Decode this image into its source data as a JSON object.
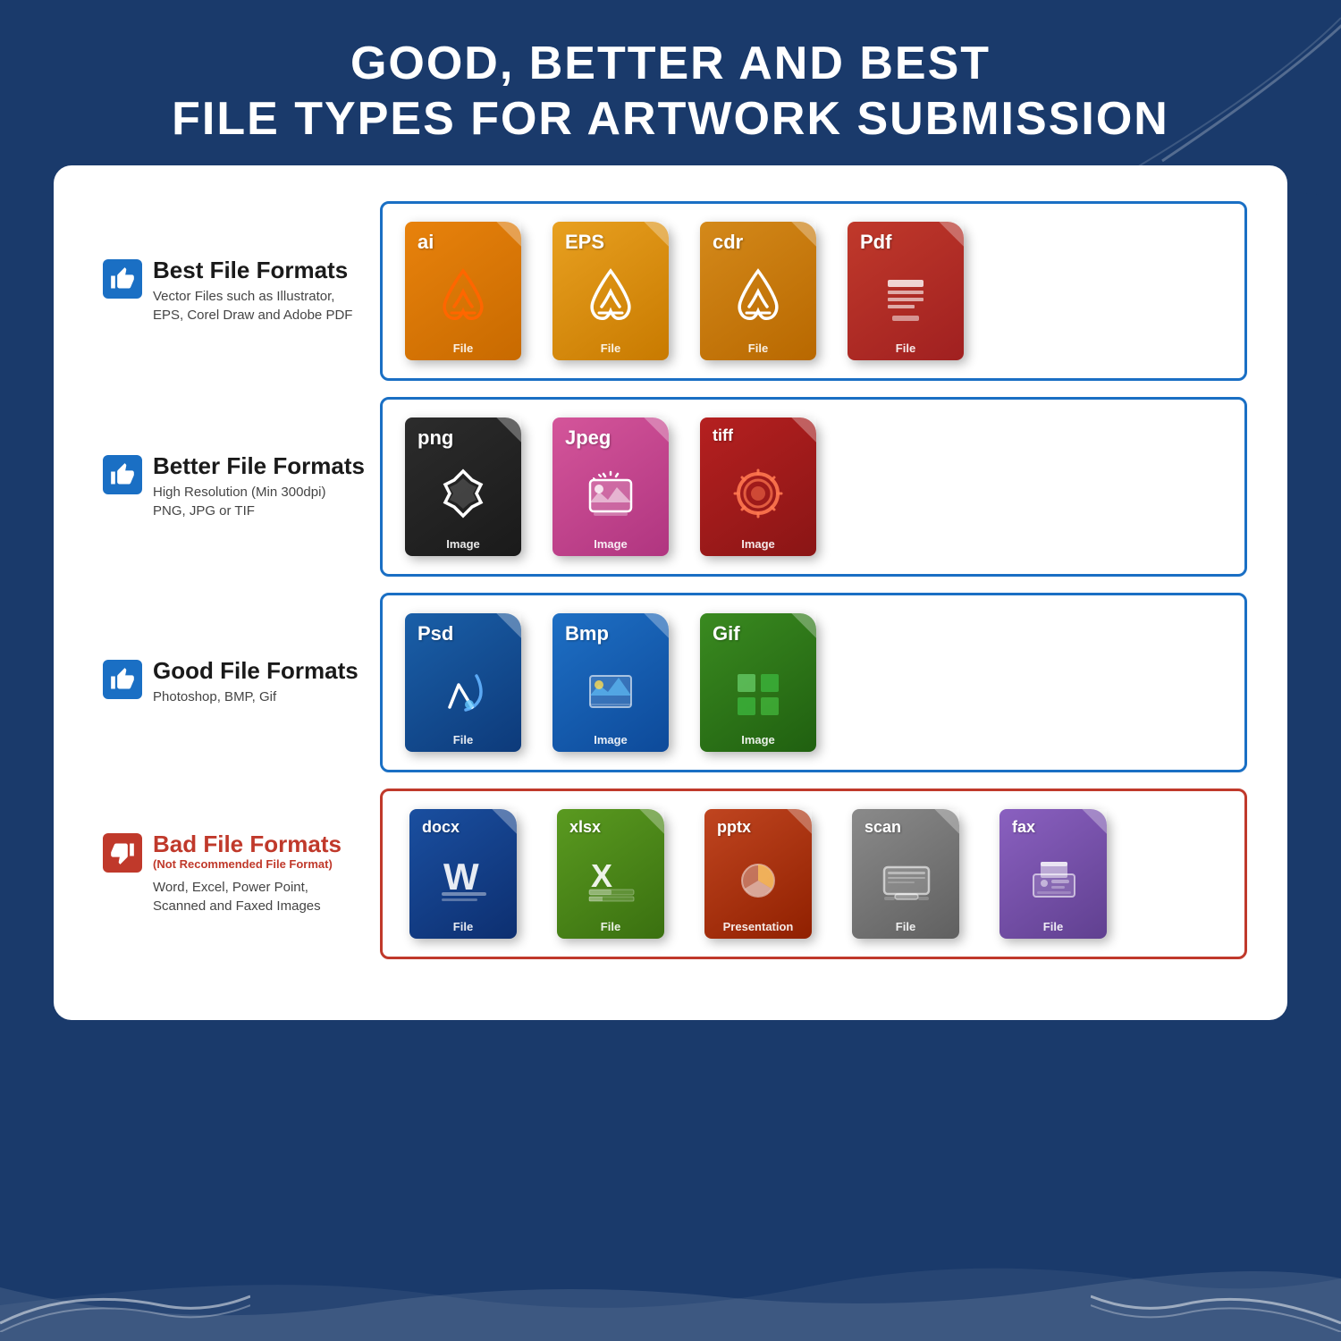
{
  "header": {
    "line1": "GOOD, BETTER AND BEST",
    "line2": "FILE TYPES FOR ARTWORK SUBMISSION"
  },
  "sections": [
    {
      "id": "best",
      "thumb": "up",
      "thumb_bad": false,
      "title": "Best File Formats",
      "subtitle": null,
      "description": "Vector Files such as Illustrator,\nEPS, Corel Draw and Adobe PDF",
      "border_color": "blue",
      "files": [
        {
          "ext": "ai",
          "color": "ai",
          "icon": "feather",
          "label": "File"
        },
        {
          "ext": "EPS",
          "color": "eps",
          "icon": "feather",
          "label": "File"
        },
        {
          "ext": "cdr",
          "color": "cdr",
          "icon": "feather",
          "label": "File"
        },
        {
          "ext": "Pdf",
          "color": "pdf",
          "icon": "doc",
          "label": "File"
        }
      ]
    },
    {
      "id": "better",
      "thumb": "up",
      "thumb_bad": false,
      "title": "Better File Formats",
      "subtitle": null,
      "description": "High Resolution (Min 300dpi)\nPNG, JPG or TIF",
      "border_color": "blue",
      "files": [
        {
          "ext": "png",
          "color": "png",
          "icon": "star",
          "label": "Image"
        },
        {
          "ext": "Jpeg",
          "color": "jpeg",
          "icon": "camera",
          "label": "Image"
        },
        {
          "ext": "tiff",
          "color": "tiff",
          "icon": "flower",
          "label": "Image"
        }
      ]
    },
    {
      "id": "good",
      "thumb": "up",
      "thumb_bad": false,
      "title": "Good File Formats",
      "subtitle": null,
      "description": "Photoshop, BMP, Gif",
      "border_color": "blue",
      "files": [
        {
          "ext": "Psd",
          "color": "psd",
          "icon": "paint",
          "label": "File"
        },
        {
          "ext": "Bmp",
          "color": "bmp",
          "icon": "landscape",
          "label": "Image"
        },
        {
          "ext": "Gif",
          "color": "gif",
          "icon": "grid",
          "label": "Image"
        }
      ]
    },
    {
      "id": "bad",
      "thumb": "down",
      "thumb_bad": true,
      "title": "Bad File Formats",
      "subtitle": "(Not Recommended File Format)",
      "description": "Word, Excel, Power Point,\nScanned and Faxed Images",
      "border_color": "red",
      "files": [
        {
          "ext": "docx",
          "color": "docx",
          "icon": "word",
          "label": "File"
        },
        {
          "ext": "xlsx",
          "color": "xlsx",
          "icon": "excel",
          "label": "File"
        },
        {
          "ext": "pptx",
          "color": "pptx",
          "icon": "ppt",
          "label": "Presentation"
        },
        {
          "ext": "scan",
          "color": "scan",
          "icon": "scanner",
          "label": "File"
        },
        {
          "ext": "fax",
          "color": "fax",
          "icon": "fax",
          "label": "File"
        }
      ]
    }
  ]
}
